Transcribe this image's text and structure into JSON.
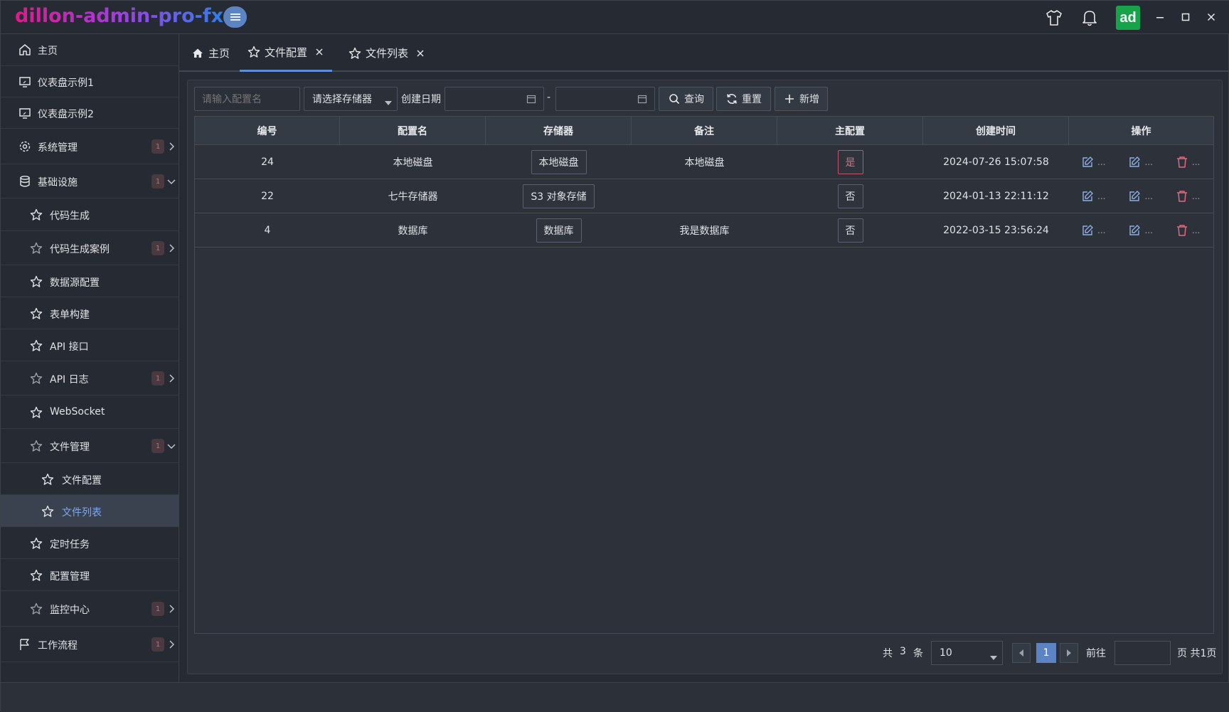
{
  "app": {
    "brand": "dillon-admin-pro-fx",
    "avatar_text": "ad"
  },
  "sidebar": {
    "items": [
      {
        "label": "主页",
        "icon": "home-icon"
      },
      {
        "label": "仪表盘示例1",
        "icon": "monitor-icon"
      },
      {
        "label": "仪表盘示例2",
        "icon": "monitor-icon"
      },
      {
        "label": "系统管理",
        "icon": "gear-icon",
        "badge": "1"
      },
      {
        "label": "基础设施",
        "icon": "database-icon",
        "badge": "1"
      },
      {
        "label": "代码生成",
        "icon": "star-icon"
      },
      {
        "label": "代码生成案例",
        "icon": "star-icon",
        "badge": "1"
      },
      {
        "label": "数据源配置",
        "icon": "star-icon"
      },
      {
        "label": "表单构建",
        "icon": "star-icon"
      },
      {
        "label": "API 接口",
        "icon": "star-icon"
      },
      {
        "label": "API 日志",
        "icon": "star-icon",
        "badge": "1"
      },
      {
        "label": "WebSocket",
        "icon": "star-icon"
      },
      {
        "label": "文件管理",
        "icon": "star-icon",
        "badge": "1"
      },
      {
        "label": "文件配置",
        "icon": "star-icon"
      },
      {
        "label": "文件列表",
        "icon": "star-icon"
      },
      {
        "label": "定时任务",
        "icon": "star-icon"
      },
      {
        "label": "配置管理",
        "icon": "star-icon"
      },
      {
        "label": "监控中心",
        "icon": "star-icon",
        "badge": "1"
      },
      {
        "label": "工作流程",
        "icon": "flag-icon",
        "badge": "1"
      }
    ]
  },
  "tabs": [
    {
      "label": "主页"
    },
    {
      "label": "文件配置"
    },
    {
      "label": "文件列表"
    }
  ],
  "toolbar": {
    "name_placeholder": "请输入配置名",
    "storage_placeholder": "请选择存储器",
    "date_label": "创建日期",
    "date_separator": "-",
    "query_label": "查询",
    "reset_label": "重置",
    "add_label": "新增"
  },
  "table": {
    "headers": [
      "编号",
      "配置名",
      "存储器",
      "备注",
      "主配置",
      "创建时间",
      "操作"
    ],
    "rows": [
      {
        "id": "24",
        "name": "本地磁盘",
        "storage": "本地磁盘",
        "remark": "本地磁盘",
        "master": "是",
        "created": "2024-07-26 15:07:58"
      },
      {
        "id": "22",
        "name": "七牛存储器",
        "storage": "S3 对象存储",
        "remark": "",
        "master": "否",
        "created": "2024-01-13 22:11:12"
      },
      {
        "id": "4",
        "name": "数据库",
        "storage": "数据库",
        "remark": "我是数据库",
        "master": "否",
        "created": "2022-03-15 23:56:24"
      }
    ],
    "op_ellipsis": "..."
  },
  "pagination": {
    "total_prefix": "共",
    "total": "3",
    "total_suffix": "条",
    "page_size": "10",
    "current_page": "1",
    "goto_label": "前往",
    "pages_suffix": "页 共1页"
  },
  "colors": {
    "accent": "#5d84c2",
    "danger": "#e06a7e",
    "success": "#17a34a"
  }
}
